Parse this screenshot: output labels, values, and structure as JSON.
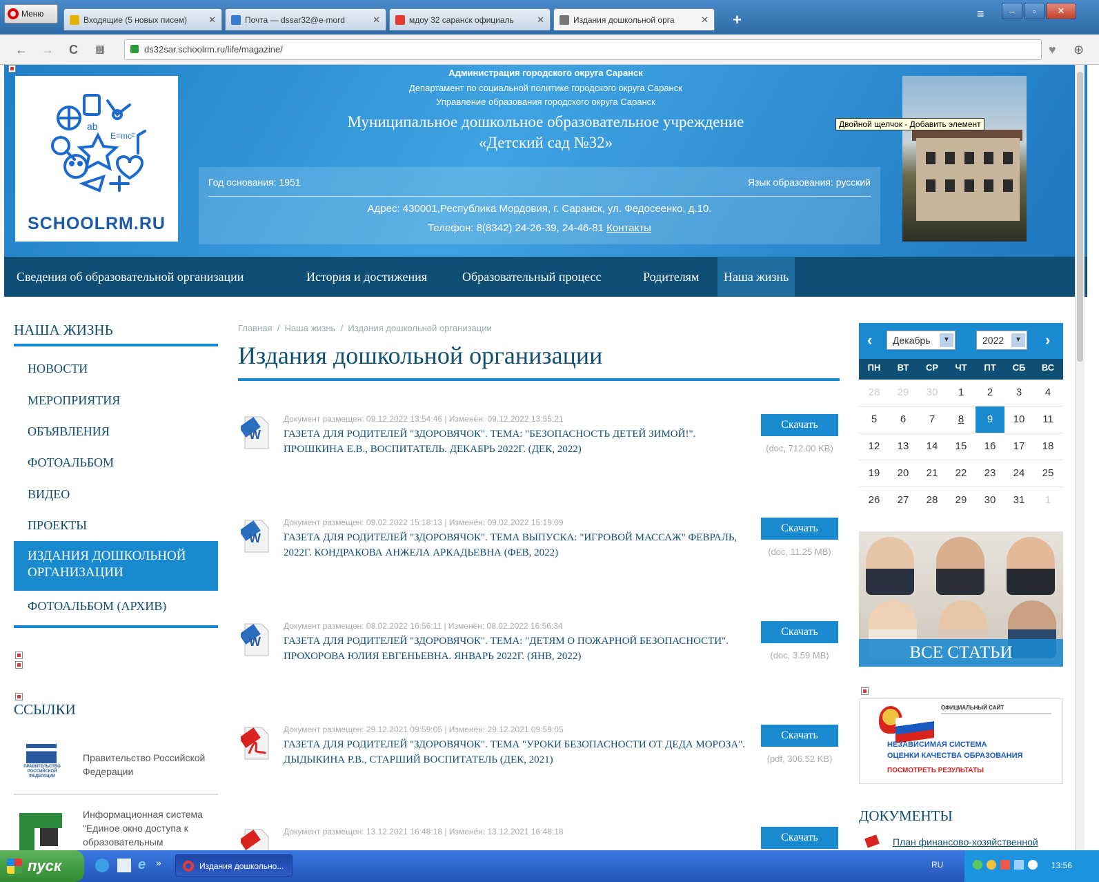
{
  "browser": {
    "menu_label": "Меню",
    "tabs": [
      {
        "label": "Входящие (5 новых писем)",
        "icon_color": "#e8b300"
      },
      {
        "label": "Почта — dssar32@e-mord",
        "icon_color": "#3a7ad0"
      },
      {
        "label": "мдоу 32 саранск официаль",
        "icon_color": "#e53935"
      },
      {
        "label": "Издания дошкольной орга",
        "icon_color": "#666666"
      }
    ],
    "url": "ds32sar.schoolrm.ru/life/magazine/"
  },
  "header": {
    "admin_line1": "Администрация городского округа Саранск",
    "admin_line2": "Департамент по социальной политике городского округа Саранск",
    "admin_line3": "Управление образования городского округа Саранск",
    "title_line1": "Муниципальное дошкольное образовательное учреждение",
    "title_line2": "«Детский сад №32»",
    "founded": "Год основания: 1951",
    "language": "Язык образования: русский",
    "address": "Адрес: 430001,Республика Мордовия, г. Саранск, ул. Федосеенко, д.10.",
    "phone": "Телефон: 8(8342) 24-26-39, 24-46-81",
    "contacts_link": "Контакты",
    "logo_text": "SCHOOLRM.RU",
    "tooltip": "Двойной щелчок - Добавить элемент"
  },
  "nav": {
    "items": [
      "Сведения об образовательной организации",
      "История и достижения",
      "Образовательный процесс",
      "Родителям",
      "Наша жизнь"
    ]
  },
  "sidebar": {
    "heading": "НАША ЖИЗНЬ",
    "items": [
      "НОВОСТИ",
      "МЕРОПРИЯТИЯ",
      "ОБЪЯВЛЕНИЯ",
      "ФОТОАЛЬБОМ",
      "ВИДЕО",
      "ПРОЕКТЫ"
    ],
    "active_item": "ИЗДАНИЯ ДОШКОЛЬНОЙ ОРГАНИЗАЦИИ",
    "after_item": "ФОТОАЛЬБОМ (АРХИВ)",
    "links_heading": "ССЫЛКИ",
    "links": [
      {
        "label": "Правительство Российской Федерации",
        "logo_text": "ПРАВИТЕЛЬСТВО РОССИЙСКОЙ ФЕДЕРАЦИИ"
      },
      {
        "label": "Информационная система \"Единое окно доступа к образовательным"
      }
    ]
  },
  "content": {
    "breadcrumb": [
      "Главная",
      "Наша жизнь",
      "Издания дошкольной организации"
    ],
    "title": "Издания дошкольной организации",
    "download_label": "Скачать",
    "docs": [
      {
        "type": "doc",
        "meta": "Документ размещен: 09.12.2022 13:54:46 | Изменён: 09.12.2022 13:55:21",
        "title": "ГАЗЕТА ДЛЯ РОДИТЕЛЕЙ \"ЗДОРОВЯЧОК\". ТЕМА: \"БЕЗОПАСНОСТЬ ДЕТЕЙ ЗИМОЙ!\". ПРОШКИНА Е.В., ВОСПИТАТЕЛЬ. ДЕКАБРЬ 2022Г. (ДЕК, 2022)",
        "size": "(doc, 712.00 KB)"
      },
      {
        "type": "doc",
        "meta": "Документ размещен: 09.02.2022 15:18:13 | Изменён: 09.02.2022 15:19:09",
        "title": "ГАЗЕТА ДЛЯ РОДИТЕЛЕЙ \"ЗДОРОВЯЧОК\". ТЕМА ВЫПУСКА: \"ИГРОВОЙ МАССАЖ\" ФЕВРАЛЬ, 2022Г. КОНДРАКОВА АНЖЕЛА АРКАДЬЕВНА (ФЕВ, 2022)",
        "size": "(doc, 11.25 MB)"
      },
      {
        "type": "doc",
        "meta": "Документ размещен: 08.02.2022 16:56:11 | Изменён: 08.02.2022 16:56:34",
        "title": "ГАЗЕТА ДЛЯ РОДИТЕЛЕЙ \"ЗДОРОВЯЧОК\". ТЕМА: \"ДЕТЯМ О ПОЖАРНОЙ БЕЗОПАСНОСТИ\". ПРОХОРОВА ЮЛИЯ ЕВГЕНЬЕВНА. ЯНВАРЬ 2022Г. (ЯНВ, 2022)",
        "size": "(doc, 3.59 MB)"
      },
      {
        "type": "pdf",
        "meta": "Документ размещен: 29.12.2021 09:59:05 | Изменён: 29.12.2021 09:59:05",
        "title": "ГАЗЕТА ДЛЯ РОДИТЕЛЕЙ \"ЗДОРОВЯЧОК\". ТЕМА \"УРОКИ БЕЗОПАСНОСТИ ОТ ДЕДА МОРОЗА\". ДЫДЫКИНА Р.В., СТАРШИЙ ВОСПИТАТЕЛЬ (ДЕК, 2021)",
        "size": "(pdf, 306.52 KB)"
      },
      {
        "type": "pdf",
        "meta": "Документ размещен: 13.12.2021 16:48:18 | Изменён: 13.12.2021 16:48:18",
        "title": "",
        "size": ""
      }
    ]
  },
  "calendar": {
    "month": "Декабрь",
    "year": "2022",
    "weekdays": [
      "ПН",
      "ВТ",
      "СР",
      "ЧТ",
      "ПТ",
      "СБ",
      "ВС"
    ],
    "weeks": [
      [
        "28",
        "29",
        "30",
        "1",
        "2",
        "3",
        "4"
      ],
      [
        "5",
        "6",
        "7",
        "8",
        "9",
        "10",
        "11"
      ],
      [
        "12",
        "13",
        "14",
        "15",
        "16",
        "17",
        "18"
      ],
      [
        "19",
        "20",
        "21",
        "22",
        "23",
        "24",
        "25"
      ],
      [
        "26",
        "27",
        "28",
        "29",
        "30",
        "31",
        "1"
      ]
    ],
    "today": "9",
    "accent": "#1a8ad0"
  },
  "right": {
    "all_articles": "ВСЕ СТАТЬИ",
    "banner_line1": "ОФИЦИАЛЬНЫЙ САЙТ",
    "banner_line2": "НЕЗАВИСИМАЯ СИСТЕМА",
    "banner_line3": "ОЦЕНКИ КАЧЕСТВА ОБРАЗОВАНИЯ",
    "banner_line4": "ПОСМОТРЕТЬ РЕЗУЛЬТАТЫ",
    "documents_heading": "ДОКУМЕНТЫ",
    "documents_first": "План финансово-хозяйственной"
  },
  "taskbar": {
    "start_label": "пуск",
    "window_label": "Издания дошкольно...",
    "lang": "RU",
    "clock": "13:56"
  },
  "colors": {
    "nav_bg": "#0f4f76",
    "accent": "#1a8ad0"
  }
}
